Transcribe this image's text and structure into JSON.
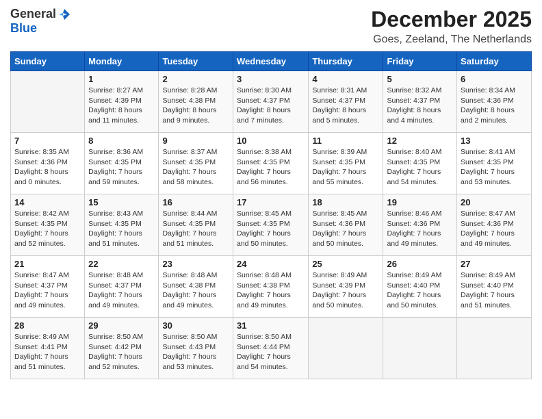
{
  "header": {
    "logo_general": "General",
    "logo_blue": "Blue",
    "month_title": "December 2025",
    "location": "Goes, Zeeland, The Netherlands"
  },
  "days_of_week": [
    "Sunday",
    "Monday",
    "Tuesday",
    "Wednesday",
    "Thursday",
    "Friday",
    "Saturday"
  ],
  "weeks": [
    [
      {
        "day": "",
        "info": ""
      },
      {
        "day": "1",
        "info": "Sunrise: 8:27 AM\nSunset: 4:39 PM\nDaylight: 8 hours\nand 11 minutes."
      },
      {
        "day": "2",
        "info": "Sunrise: 8:28 AM\nSunset: 4:38 PM\nDaylight: 8 hours\nand 9 minutes."
      },
      {
        "day": "3",
        "info": "Sunrise: 8:30 AM\nSunset: 4:37 PM\nDaylight: 8 hours\nand 7 minutes."
      },
      {
        "day": "4",
        "info": "Sunrise: 8:31 AM\nSunset: 4:37 PM\nDaylight: 8 hours\nand 5 minutes."
      },
      {
        "day": "5",
        "info": "Sunrise: 8:32 AM\nSunset: 4:37 PM\nDaylight: 8 hours\nand 4 minutes."
      },
      {
        "day": "6",
        "info": "Sunrise: 8:34 AM\nSunset: 4:36 PM\nDaylight: 8 hours\nand 2 minutes."
      }
    ],
    [
      {
        "day": "7",
        "info": "Sunrise: 8:35 AM\nSunset: 4:36 PM\nDaylight: 8 hours\nand 0 minutes."
      },
      {
        "day": "8",
        "info": "Sunrise: 8:36 AM\nSunset: 4:35 PM\nDaylight: 7 hours\nand 59 minutes."
      },
      {
        "day": "9",
        "info": "Sunrise: 8:37 AM\nSunset: 4:35 PM\nDaylight: 7 hours\nand 58 minutes."
      },
      {
        "day": "10",
        "info": "Sunrise: 8:38 AM\nSunset: 4:35 PM\nDaylight: 7 hours\nand 56 minutes."
      },
      {
        "day": "11",
        "info": "Sunrise: 8:39 AM\nSunset: 4:35 PM\nDaylight: 7 hours\nand 55 minutes."
      },
      {
        "day": "12",
        "info": "Sunrise: 8:40 AM\nSunset: 4:35 PM\nDaylight: 7 hours\nand 54 minutes."
      },
      {
        "day": "13",
        "info": "Sunrise: 8:41 AM\nSunset: 4:35 PM\nDaylight: 7 hours\nand 53 minutes."
      }
    ],
    [
      {
        "day": "14",
        "info": "Sunrise: 8:42 AM\nSunset: 4:35 PM\nDaylight: 7 hours\nand 52 minutes."
      },
      {
        "day": "15",
        "info": "Sunrise: 8:43 AM\nSunset: 4:35 PM\nDaylight: 7 hours\nand 51 minutes."
      },
      {
        "day": "16",
        "info": "Sunrise: 8:44 AM\nSunset: 4:35 PM\nDaylight: 7 hours\nand 51 minutes."
      },
      {
        "day": "17",
        "info": "Sunrise: 8:45 AM\nSunset: 4:35 PM\nDaylight: 7 hours\nand 50 minutes."
      },
      {
        "day": "18",
        "info": "Sunrise: 8:45 AM\nSunset: 4:36 PM\nDaylight: 7 hours\nand 50 minutes."
      },
      {
        "day": "19",
        "info": "Sunrise: 8:46 AM\nSunset: 4:36 PM\nDaylight: 7 hours\nand 49 minutes."
      },
      {
        "day": "20",
        "info": "Sunrise: 8:47 AM\nSunset: 4:36 PM\nDaylight: 7 hours\nand 49 minutes."
      }
    ],
    [
      {
        "day": "21",
        "info": "Sunrise: 8:47 AM\nSunset: 4:37 PM\nDaylight: 7 hours\nand 49 minutes."
      },
      {
        "day": "22",
        "info": "Sunrise: 8:48 AM\nSunset: 4:37 PM\nDaylight: 7 hours\nand 49 minutes."
      },
      {
        "day": "23",
        "info": "Sunrise: 8:48 AM\nSunset: 4:38 PM\nDaylight: 7 hours\nand 49 minutes."
      },
      {
        "day": "24",
        "info": "Sunrise: 8:48 AM\nSunset: 4:38 PM\nDaylight: 7 hours\nand 49 minutes."
      },
      {
        "day": "25",
        "info": "Sunrise: 8:49 AM\nSunset: 4:39 PM\nDaylight: 7 hours\nand 50 minutes."
      },
      {
        "day": "26",
        "info": "Sunrise: 8:49 AM\nSunset: 4:40 PM\nDaylight: 7 hours\nand 50 minutes."
      },
      {
        "day": "27",
        "info": "Sunrise: 8:49 AM\nSunset: 4:40 PM\nDaylight: 7 hours\nand 51 minutes."
      }
    ],
    [
      {
        "day": "28",
        "info": "Sunrise: 8:49 AM\nSunset: 4:41 PM\nDaylight: 7 hours\nand 51 minutes."
      },
      {
        "day": "29",
        "info": "Sunrise: 8:50 AM\nSunset: 4:42 PM\nDaylight: 7 hours\nand 52 minutes."
      },
      {
        "day": "30",
        "info": "Sunrise: 8:50 AM\nSunset: 4:43 PM\nDaylight: 7 hours\nand 53 minutes."
      },
      {
        "day": "31",
        "info": "Sunrise: 8:50 AM\nSunset: 4:44 PM\nDaylight: 7 hours\nand 54 minutes."
      },
      {
        "day": "",
        "info": ""
      },
      {
        "day": "",
        "info": ""
      },
      {
        "day": "",
        "info": ""
      }
    ]
  ]
}
